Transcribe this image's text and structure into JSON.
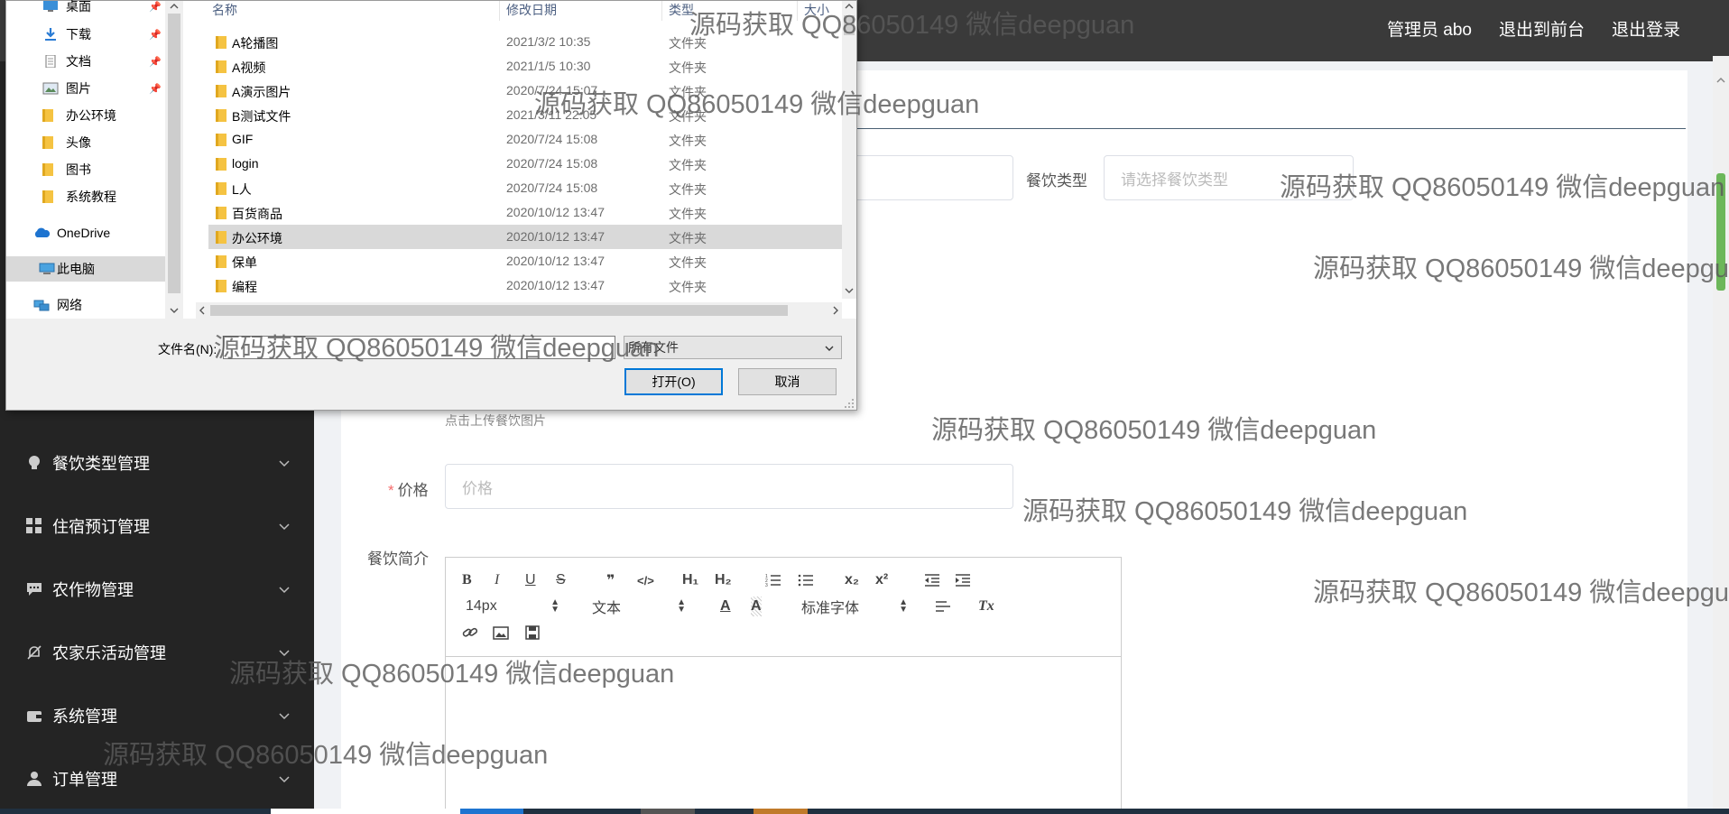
{
  "header": {
    "user": "管理员 abo",
    "to_front": "退出到前台",
    "logout": "退出登录"
  },
  "sidebar": {
    "items": [
      {
        "label": "餐饮类型管理",
        "icon": "bulb-icon"
      },
      {
        "label": "住宿预订管理",
        "icon": "grid-icon"
      },
      {
        "label": "农作物管理",
        "icon": "chat-icon"
      },
      {
        "label": "农家乐活动管理",
        "icon": "bell-off-icon"
      },
      {
        "label": "系统管理",
        "icon": "wallet-icon"
      },
      {
        "label": "订单管理",
        "icon": "user-icon"
      }
    ]
  },
  "form": {
    "catering_type_label": "餐饮类型",
    "catering_type_placeholder": "请选择餐饮类型",
    "upload_hint": "点击上传餐饮图片",
    "price_label": "价格",
    "price_required": "*",
    "price_placeholder": "价格",
    "intro_label": "餐饮简介"
  },
  "editor": {
    "font_size": "14px",
    "paragraph": "文本",
    "font_family": "标准字体",
    "tools": {
      "bold": "B",
      "italic": "I",
      "underline": "U",
      "strike": "S",
      "quote": "❞",
      "code": "</>",
      "h1": "H₁",
      "h2": "H₂",
      "sub": "x₂",
      "sup": "x²",
      "clear": "Tx"
    }
  },
  "dialog": {
    "nav_items": [
      {
        "label": "桌面",
        "icon": "desktop-icon",
        "pinned": true
      },
      {
        "label": "下载",
        "icon": "download-icon",
        "pinned": true
      },
      {
        "label": "文档",
        "icon": "document-icon",
        "pinned": true
      },
      {
        "label": "图片",
        "icon": "picture-icon",
        "pinned": true
      },
      {
        "label": "办公环境",
        "icon": "folder-icon",
        "pinned": false
      },
      {
        "label": "头像",
        "icon": "folder-icon",
        "pinned": false
      },
      {
        "label": "图书",
        "icon": "folder-icon",
        "pinned": false
      },
      {
        "label": "系统教程",
        "icon": "folder-icon",
        "pinned": false
      },
      {
        "label": "OneDrive",
        "icon": "cloud-icon",
        "pinned": false
      },
      {
        "label": "此电脑",
        "icon": "computer-icon",
        "pinned": false
      },
      {
        "label": "网络",
        "icon": "network-icon",
        "pinned": false
      }
    ],
    "columns": {
      "name": "名称",
      "modified": "修改日期",
      "type": "类型",
      "size": "大小"
    },
    "files": [
      {
        "name": "A轮播图",
        "date": "2021/3/2 10:35",
        "type": "文件夹"
      },
      {
        "name": "A视频",
        "date": "2021/1/5 10:30",
        "type": "文件夹"
      },
      {
        "name": "A演示图片",
        "date": "2020/7/24 15:07",
        "type": "文件夹"
      },
      {
        "name": "B测试文件",
        "date": "2021/3/11 22:05",
        "type": "文件夹"
      },
      {
        "name": "GIF",
        "date": "2020/7/24 15:08",
        "type": "文件夹"
      },
      {
        "name": "login",
        "date": "2020/7/24 15:08",
        "type": "文件夹"
      },
      {
        "name": "L人",
        "date": "2020/7/24 15:08",
        "type": "文件夹"
      },
      {
        "name": "百货商品",
        "date": "2020/10/12 13:47",
        "type": "文件夹"
      },
      {
        "name": "办公环境",
        "date": "2020/10/12 13:47",
        "type": "文件夹",
        "selected": true
      },
      {
        "name": "保单",
        "date": "2020/10/12 13:47",
        "type": "文件夹"
      },
      {
        "name": "编程",
        "date": "2020/10/12 13:47",
        "type": "文件夹"
      }
    ],
    "filename_label": "文件名(N):",
    "filename_value": "",
    "filter_value": "所有文件",
    "open_button": "打开(O)",
    "cancel_button": "取消"
  },
  "watermark": "源码获取 QQ86050149 微信deepguan",
  "colors": {
    "header_bg": "#3a3a3a",
    "sidebar_bg": "#242424",
    "required": "#f56c6c",
    "selection": "#d9d9d9",
    "primary_border": "#0078d7"
  }
}
